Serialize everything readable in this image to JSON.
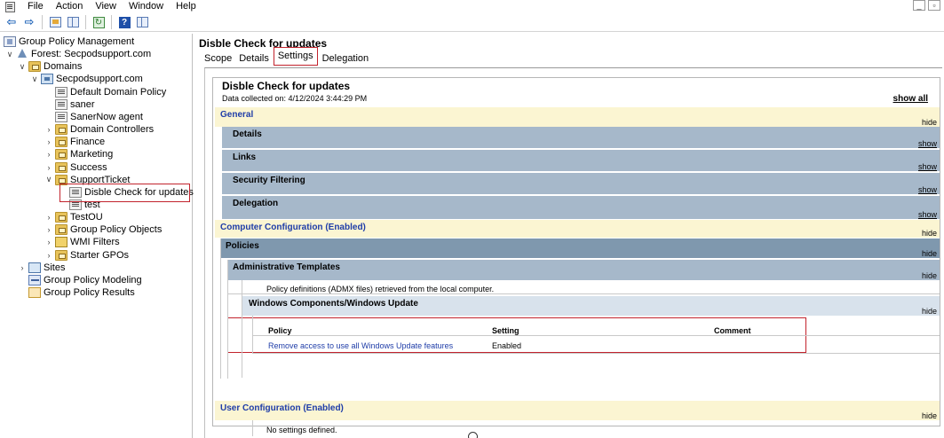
{
  "menu": {
    "items": [
      "File",
      "Action",
      "View",
      "Window",
      "Help"
    ],
    "window_controls": [
      "_",
      "▫"
    ]
  },
  "toolbar": {
    "buttons": [
      "back-icon",
      "forward-icon",
      "up-folder-icon",
      "show-hide-tree-icon",
      "refresh-icon",
      "help-icon",
      "properties-icon"
    ]
  },
  "tree": {
    "items": [
      {
        "label": "Group Policy Management",
        "icon": "gpm-icon",
        "level": 0,
        "chevron": ""
      },
      {
        "label": "Forest: Secpodsupport.com",
        "icon": "forest-icon",
        "level": 0,
        "chevron": "v"
      },
      {
        "label": "Domains",
        "icon": "folder-icon",
        "level": 1,
        "chevron": "v"
      },
      {
        "label": "Secpodsupport.com",
        "icon": "domain-icon",
        "level": 2,
        "chevron": "v"
      },
      {
        "label": "Default Domain Policy",
        "icon": "gpo-icon",
        "level": 3,
        "chevron": ""
      },
      {
        "label": "saner",
        "icon": "gpo-icon",
        "level": 3,
        "chevron": ""
      },
      {
        "label": "SanerNow agent",
        "icon": "gpo-icon",
        "level": 3,
        "chevron": ""
      },
      {
        "label": "Domain Controllers",
        "icon": "folder-icon",
        "level": 3,
        "chevron": ">"
      },
      {
        "label": "Finance",
        "icon": "folder-icon",
        "level": 3,
        "chevron": ">"
      },
      {
        "label": "Marketing",
        "icon": "folder-icon",
        "level": 3,
        "chevron": ">"
      },
      {
        "label": "Success",
        "icon": "folder-icon",
        "level": 3,
        "chevron": ">"
      },
      {
        "label": "SupportTicket",
        "icon": "folder-icon",
        "level": 3,
        "chevron": "v"
      },
      {
        "label": "Disble Check for updates",
        "icon": "gpo-icon",
        "level": 4,
        "chevron": "",
        "selected": true
      },
      {
        "label": "test",
        "icon": "gpo-icon",
        "level": 4,
        "chevron": ""
      },
      {
        "label": "TestOU",
        "icon": "folder-icon",
        "level": 3,
        "chevron": ">"
      },
      {
        "label": "Group Policy Objects",
        "icon": "folder-icon",
        "level": 3,
        "chevron": ">"
      },
      {
        "label": "WMI Filters",
        "icon": "wmi-icon",
        "level": 3,
        "chevron": ">"
      },
      {
        "label": "Starter GPOs",
        "icon": "folder-icon",
        "level": 3,
        "chevron": ">"
      },
      {
        "label": "Sites",
        "icon": "site-icon",
        "level": 1,
        "chevron": ">"
      },
      {
        "label": "Group Policy Modeling",
        "icon": "model-icon",
        "level": 1,
        "chevron": ""
      },
      {
        "label": "Group Policy Results",
        "icon": "results-icon",
        "level": 1,
        "chevron": ""
      }
    ]
  },
  "right": {
    "title": "Disble Check for updates",
    "tabs": [
      "Scope",
      "Details",
      "Settings",
      "Delegation"
    ],
    "active_tab": "Settings"
  },
  "report": {
    "title": "Disble Check for updates",
    "collected": "Data collected on: 4/12/2024 3:44:29 PM",
    "show_all": "show all",
    "general": {
      "label": "General",
      "action": "hide"
    },
    "general_items": [
      {
        "label": "Details",
        "action": "show"
      },
      {
        "label": "Links",
        "action": "show"
      },
      {
        "label": "Security Filtering",
        "action": "show"
      },
      {
        "label": "Delegation",
        "action": "show"
      }
    ],
    "computer": {
      "label": "Computer Configuration (Enabled)",
      "action": "hide"
    },
    "policies": {
      "label": "Policies",
      "action": "hide"
    },
    "admin_templates": {
      "label": "Administrative Templates",
      "action": "hide"
    },
    "admx_note": "Policy definitions (ADMX files) retrieved from the local computer.",
    "windows_update": {
      "label": "Windows Components/Windows Update",
      "action": "hide"
    },
    "table": {
      "headers": [
        "Policy",
        "Setting",
        "Comment"
      ],
      "rows": [
        {
          "policy": "Remove access to use all Windows Update features",
          "setting": "Enabled",
          "comment": ""
        }
      ]
    },
    "user": {
      "label": "User Configuration (Enabled)",
      "action": "hide"
    },
    "user_note": "No settings defined."
  },
  "colors": {
    "section_band": "#fbf5d2",
    "section_text": "#1f3da8",
    "sub_band": "#a6b8ca",
    "policies_band": "#7f98ae",
    "highlight_border": "#c2232d"
  }
}
